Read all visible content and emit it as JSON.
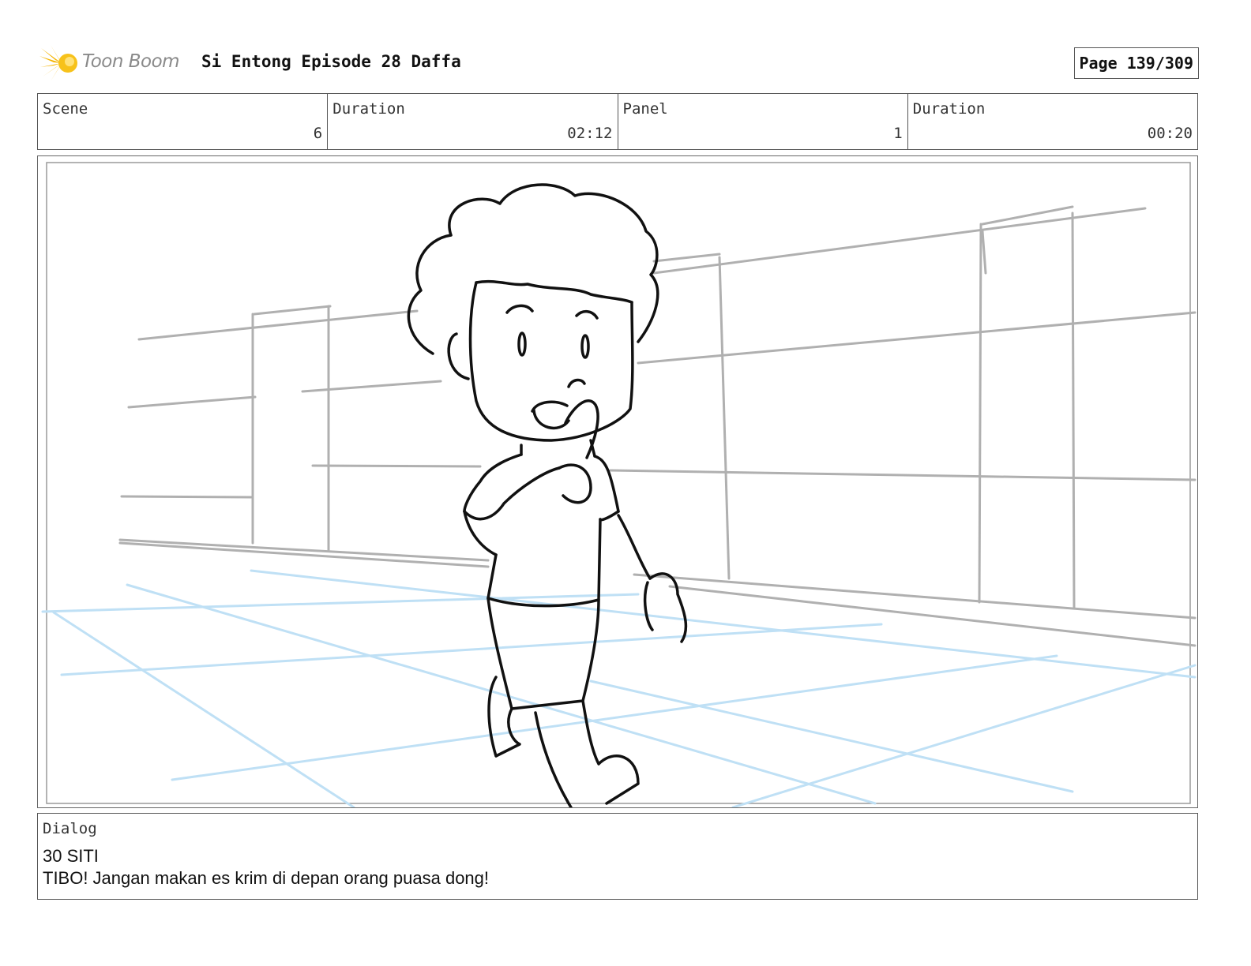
{
  "header": {
    "logo_text": "Toon Boom",
    "title": "Si Entong Episode 28 Daffa",
    "page": "Page 139/309"
  },
  "info": {
    "scene_label": "Scene",
    "scene_value": "6",
    "scene_duration_label": "Duration",
    "scene_duration_value": "02:12",
    "panel_label": "Panel",
    "panel_value": "1",
    "panel_duration_label": "Duration",
    "panel_duration_value": "00:20"
  },
  "dialog": {
    "label": "Dialog",
    "lines": [
      "30 SITI",
      "TIBO! Jangan makan es krim di depan orang puasa dong!"
    ]
  },
  "colors": {
    "logo_yellow": "#f5b400",
    "sketch_grey": "#b0b0b0",
    "sketch_blue": "#bfe0f5",
    "ink": "#111111"
  }
}
